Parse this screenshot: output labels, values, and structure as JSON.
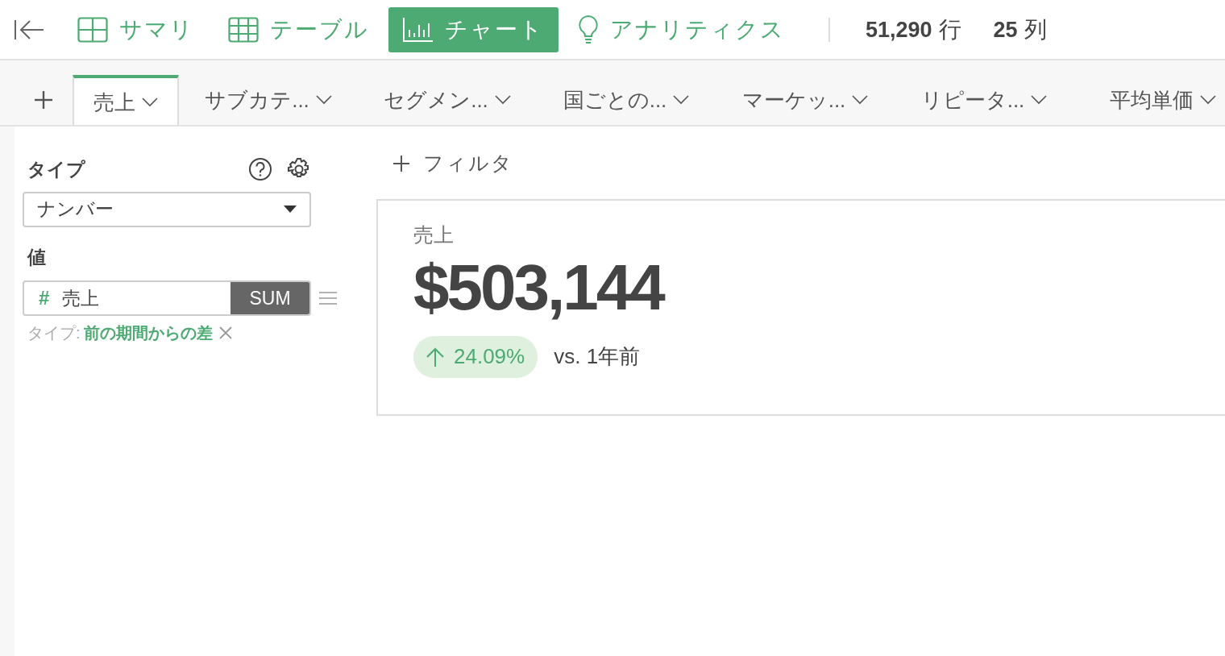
{
  "toolbar": {
    "views": [
      {
        "kind": "summary",
        "label": "サマリ",
        "selected": false
      },
      {
        "kind": "table",
        "label": "テーブル",
        "selected": false
      },
      {
        "kind": "chart",
        "label": "チャート",
        "selected": true
      },
      {
        "kind": "analytics",
        "label": "アナリティクス",
        "selected": false
      }
    ],
    "stats": [
      {
        "value": "51,290",
        "unit": "行"
      },
      {
        "value": "25",
        "unit": "列"
      }
    ]
  },
  "tabs": [
    {
      "label": "売上",
      "selected": true
    },
    {
      "label": "サブカテ...",
      "selected": false
    },
    {
      "label": "セグメン...",
      "selected": false
    },
    {
      "label": "国ごとの...",
      "selected": false
    },
    {
      "label": "マーケッ...",
      "selected": false
    },
    {
      "label": "リピータ...",
      "selected": false
    },
    {
      "label": "平均単価",
      "selected": false
    }
  ],
  "settings": {
    "type_label": "タイプ",
    "type_value": "ナンバー",
    "value_label": "値",
    "value_field": {
      "symbol": "#",
      "name": "売上",
      "aggregation": "SUM"
    },
    "calc_prefix": "タイプ:",
    "calc_type": "前の期間からの差"
  },
  "filter": {
    "label": "フィルタ"
  },
  "card": {
    "title": "売上",
    "value": "$503,144",
    "change": "24.09%",
    "comparison": "vs. 1年前"
  }
}
